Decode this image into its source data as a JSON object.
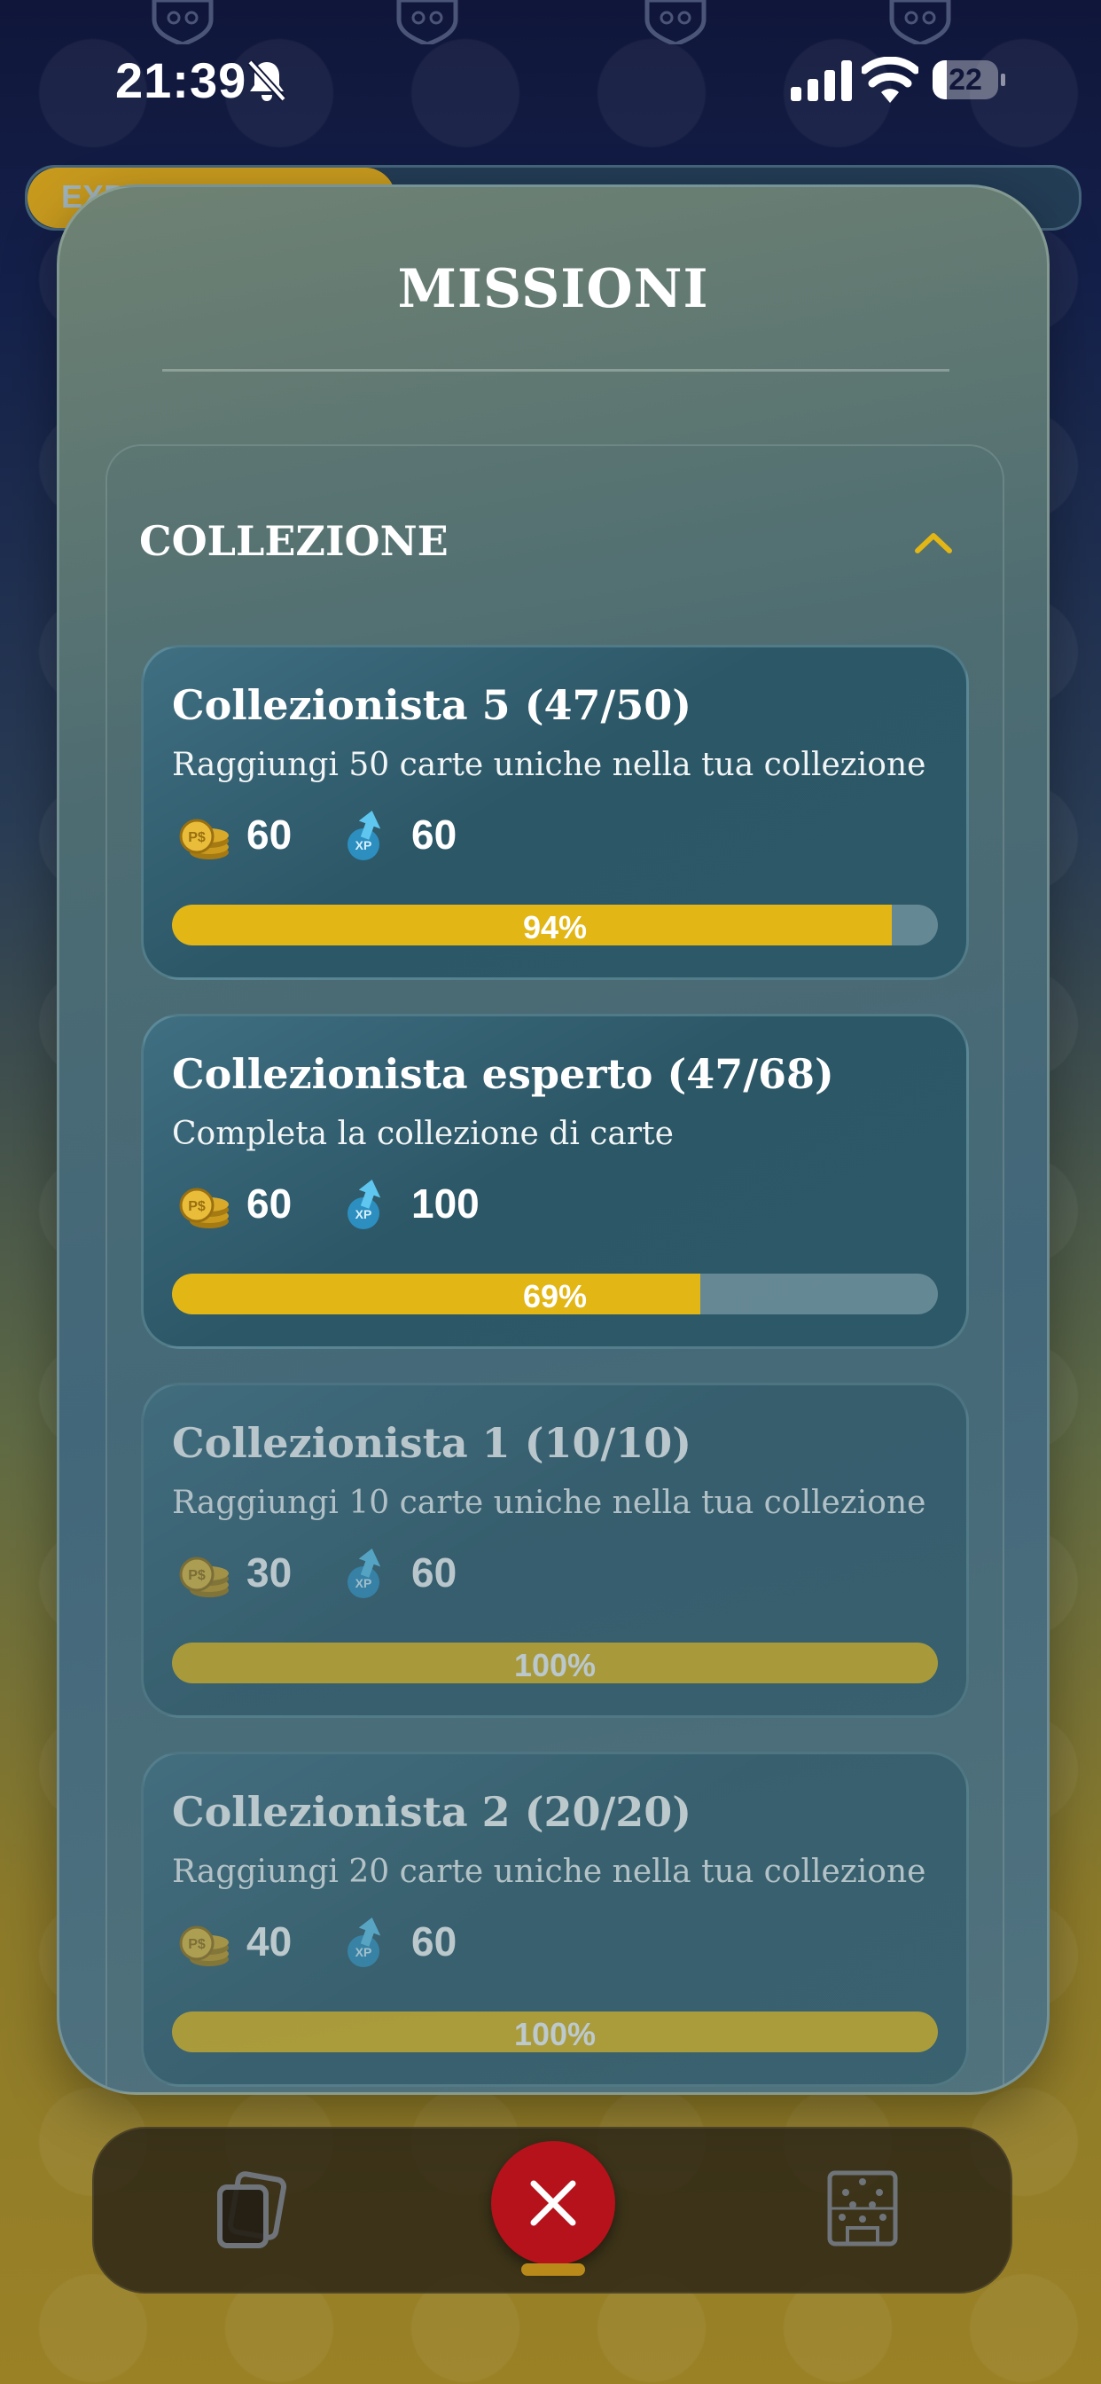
{
  "status_bar": {
    "time": "21:39",
    "battery": "22",
    "battery_level": 0.22
  },
  "background": {
    "xp_bar_label": "EXP",
    "xp_fill": 0.35
  },
  "modal": {
    "title": "MISSIONI"
  },
  "section": {
    "title": "COLLEZIONE",
    "accent_color": "#e2b614"
  },
  "missions": [
    {
      "title": "Collezionista 5 (47/50)",
      "description": "Raggiungi 50 carte uniche nella tua collezione",
      "coins": "60",
      "xp": "60",
      "progress_label": "94%",
      "progress": 0.94,
      "completed": false
    },
    {
      "title": "Collezionista esperto (47/68)",
      "description": "Completa la collezione di carte",
      "coins": "60",
      "xp": "100",
      "progress_label": "69%",
      "progress": 0.69,
      "completed": false
    },
    {
      "title": "Collezionista 1 (10/10)",
      "description": "Raggiungi 10 carte uniche nella tua collezione",
      "coins": "30",
      "xp": "60",
      "progress_label": "100%",
      "progress": 1.0,
      "completed": true
    },
    {
      "title": "Collezionista 2 (20/20)",
      "description": "Raggiungi 20 carte uniche nella tua collezione",
      "coins": "40",
      "xp": "60",
      "progress_label": "100%",
      "progress": 1.0,
      "completed": true
    }
  ],
  "icons": {
    "coin": "coin-stack-icon",
    "xp": "xp-arrow-icon",
    "cards": "cards-icon",
    "close": "close-icon",
    "field": "field-icon"
  },
  "colors": {
    "progress_fill": "#e2b614",
    "close_button": "#b5121b"
  }
}
